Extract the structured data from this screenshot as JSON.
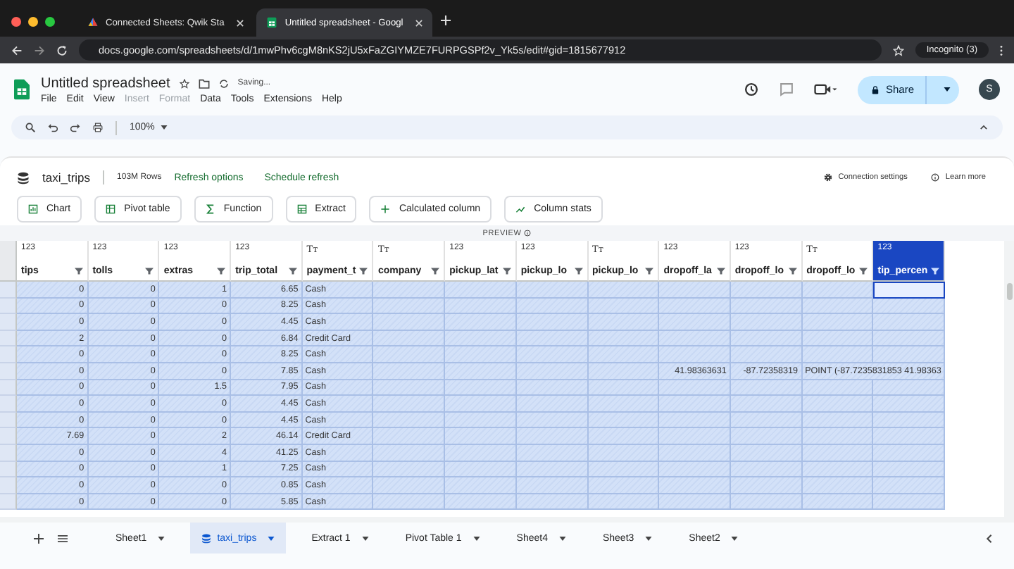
{
  "browser": {
    "tabs": [
      {
        "title": "Connected Sheets: Qwik Sta",
        "selected": false
      },
      {
        "title": "Untitled spreadsheet - Googl",
        "selected": true
      }
    ],
    "url": "docs.google.com/spreadsheets/d/1mwPhv6cgM8nKS2jU5xFaZGIYMZE7FURPGSPf2v_Yk5s/edit#gid=1815677912",
    "profile": "Incognito (3)"
  },
  "document": {
    "title": "Untitled spreadsheet",
    "status": "Saving...",
    "avatar": "S",
    "share": "Share"
  },
  "menu": [
    {
      "label": "File",
      "disabled": false
    },
    {
      "label": "Edit",
      "disabled": false
    },
    {
      "label": "View",
      "disabled": false
    },
    {
      "label": "Insert",
      "disabled": true
    },
    {
      "label": "Format",
      "disabled": true
    },
    {
      "label": "Data",
      "disabled": false
    },
    {
      "label": "Tools",
      "disabled": false
    },
    {
      "label": "Extensions",
      "disabled": false
    },
    {
      "label": "Help",
      "disabled": false
    }
  ],
  "toolbar": {
    "zoom": "100%"
  },
  "connection": {
    "table": "taxi_trips",
    "rows": "103M Rows",
    "links": [
      "Refresh options",
      "Schedule refresh"
    ],
    "settings": "Connection settings",
    "learn_more": "Learn more",
    "actions": [
      {
        "kind": "chart",
        "label": "Chart"
      },
      {
        "kind": "pivot",
        "label": "Pivot table"
      },
      {
        "kind": "function",
        "label": "Function"
      },
      {
        "kind": "extract",
        "label": "Extract"
      },
      {
        "kind": "calculated",
        "label": "Calculated column"
      },
      {
        "kind": "stats",
        "label": "Column stats"
      }
    ],
    "preview": "PREVIEW"
  },
  "table": {
    "columns": [
      {
        "type": "123",
        "name": "tips",
        "selected": false
      },
      {
        "type": "123",
        "name": "tolls",
        "selected": false
      },
      {
        "type": "123",
        "name": "extras",
        "selected": false
      },
      {
        "type": "123",
        "name": "trip_total",
        "selected": false
      },
      {
        "type": "Tт",
        "name": "payment_t",
        "selected": false
      },
      {
        "type": "Tт",
        "name": "company",
        "selected": false
      },
      {
        "type": "123",
        "name": "pickup_lat",
        "selected": false
      },
      {
        "type": "123",
        "name": "pickup_lo",
        "selected": false
      },
      {
        "type": "Tт",
        "name": "pickup_lo",
        "selected": false
      },
      {
        "type": "123",
        "name": "dropoff_la",
        "selected": false
      },
      {
        "type": "123",
        "name": "dropoff_lo",
        "selected": false
      },
      {
        "type": "Tт",
        "name": "dropoff_lo",
        "selected": false
      },
      {
        "type": "123",
        "name": "tip_percen",
        "selected": true
      }
    ],
    "rows": [
      {
        "cells": [
          "0",
          "0",
          "1",
          "6.65",
          "Cash",
          null,
          null,
          null,
          null,
          null,
          null,
          null,
          null
        ]
      },
      {
        "cells": [
          "0",
          "0",
          "0",
          "8.25",
          "Cash",
          null,
          null,
          null,
          null,
          null,
          null,
          null,
          null
        ]
      },
      {
        "cells": [
          "0",
          "0",
          "0",
          "4.45",
          "Cash",
          null,
          null,
          null,
          null,
          null,
          null,
          null,
          null
        ]
      },
      {
        "cells": [
          "2",
          "0",
          "0",
          "6.84",
          "Credit Card",
          null,
          null,
          null,
          null,
          null,
          null,
          null,
          null
        ]
      },
      {
        "cells": [
          "0",
          "0",
          "0",
          "8.25",
          "Cash",
          null,
          null,
          null,
          null,
          null,
          null,
          null,
          null
        ]
      },
      {
        "cells": [
          "0",
          "0",
          "0",
          "7.85",
          "Cash",
          null,
          null,
          null,
          null,
          "41.98363631",
          "-87.72358319",
          "POINT (-87.7235831853 41.98363",
          null
        ]
      },
      {
        "cells": [
          "0",
          "0",
          "1.5",
          "7.95",
          "Cash",
          null,
          null,
          null,
          null,
          null,
          null,
          null,
          null
        ]
      },
      {
        "cells": [
          "0",
          "0",
          "0",
          "4.45",
          "Cash",
          null,
          null,
          null,
          null,
          null,
          null,
          null,
          null
        ]
      },
      {
        "cells": [
          "0",
          "0",
          "0",
          "4.45",
          "Cash",
          null,
          null,
          null,
          null,
          null,
          null,
          null,
          null
        ]
      },
      {
        "cells": [
          "7.69",
          "0",
          "2",
          "46.14",
          "Credit Card",
          null,
          null,
          null,
          null,
          null,
          null,
          null,
          null
        ]
      },
      {
        "cells": [
          "0",
          "0",
          "4",
          "41.25",
          "Cash",
          null,
          null,
          null,
          null,
          null,
          null,
          null,
          null
        ]
      },
      {
        "cells": [
          "0",
          "0",
          "1",
          "7.25",
          "Cash",
          null,
          null,
          null,
          null,
          null,
          null,
          null,
          null
        ]
      },
      {
        "cells": [
          "0",
          "0",
          "0",
          "0.85",
          "Cash",
          null,
          null,
          null,
          null,
          null,
          null,
          null,
          null
        ]
      },
      {
        "cells": [
          "0",
          "0",
          "0",
          "5.85",
          "Cash",
          null,
          null,
          null,
          null,
          null,
          null,
          null,
          null
        ]
      }
    ]
  },
  "sheets": [
    {
      "name": "Sheet1",
      "selected": false,
      "kind": "sheet"
    },
    {
      "name": "taxi_trips",
      "selected": true,
      "kind": "connected"
    },
    {
      "name": "Extract 1",
      "selected": false,
      "kind": "sheet"
    },
    {
      "name": "Pivot Table 1",
      "selected": false,
      "kind": "sheet"
    },
    {
      "name": "Sheet4",
      "selected": false,
      "kind": "sheet"
    },
    {
      "name": "Sheet3",
      "selected": false,
      "kind": "sheet"
    },
    {
      "name": "Sheet2",
      "selected": false,
      "kind": "sheet"
    }
  ]
}
